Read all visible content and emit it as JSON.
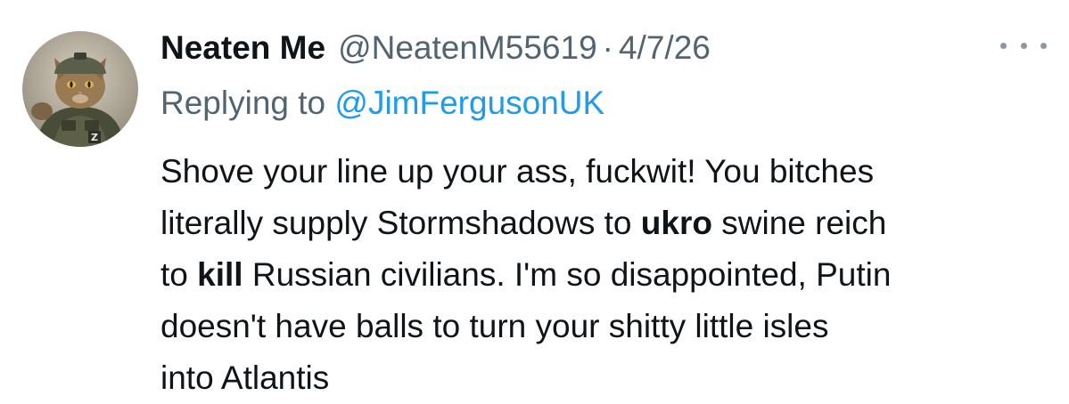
{
  "tweet": {
    "display_name": "Neaten Me",
    "handle": "@NeatenM55619",
    "separator": "·",
    "date": "4/7/26",
    "more_icon": "more-horizontal-icon",
    "avatar": {
      "description_icon": "cat-soldier-avatar",
      "badge_letter": "Z"
    },
    "replying_label": "Replying to ",
    "replying_handle": "@JimFergusonUK",
    "body_lines": [
      [
        "Shove your line up your ass, fuckwit! You bitches"
      ],
      [
        "literally supply Stormshadows to ",
        "ukro",
        " swine reich"
      ],
      [
        "to ",
        "kill",
        " Russian civilians. I'm so disappointed, Putin"
      ],
      [
        "doesn't have balls to turn your shitty little isles"
      ],
      [
        "into Atlantis"
      ]
    ]
  },
  "colors": {
    "text_primary": "#0f1419",
    "text_secondary": "#536471",
    "link": "#1d9bf0",
    "more_dots": "#8b98a5"
  }
}
